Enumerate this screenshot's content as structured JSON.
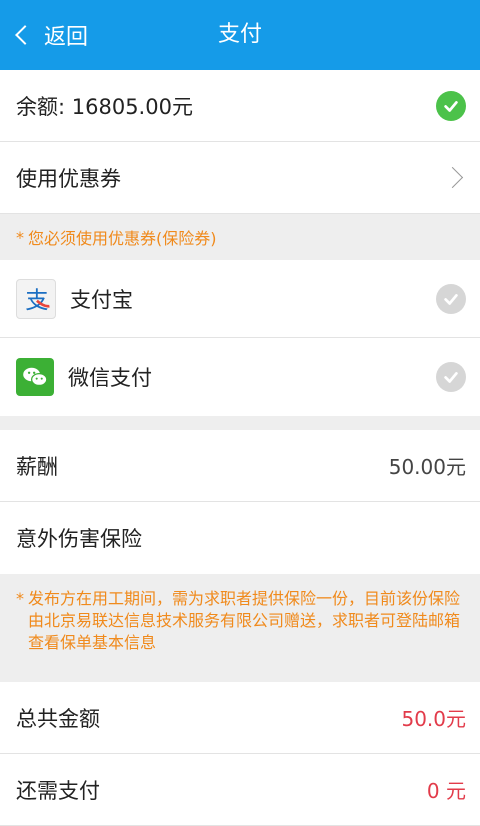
{
  "header": {
    "back_label": "返回",
    "title": "支付"
  },
  "balance": {
    "label": "余额: 16805.00元"
  },
  "coupon": {
    "label": "使用优惠券",
    "note": "您必须使用优惠券(保险券)"
  },
  "payment_methods": [
    {
      "label": "支付宝",
      "icon": "alipay-icon"
    },
    {
      "label": "微信支付",
      "icon": "wechat-icon"
    }
  ],
  "salary": {
    "label": "薪酬",
    "value": "50.00元"
  },
  "insurance": {
    "label": "意外伤害保险",
    "note": "发布方在用工期间，需为求职者提供保险一份，目前该份保险由北京易联达信息技术服务有限公司赠送，求职者可登陆邮箱查看保单基本信息"
  },
  "total": {
    "label": "总共金额",
    "value": "50.0元"
  },
  "remaining": {
    "label": "还需支付",
    "value": "0 元"
  },
  "colors": {
    "header": "#159be8",
    "accent_orange": "#f08a1c",
    "price_red": "#e23b4a",
    "check_green": "#4cc24a"
  }
}
